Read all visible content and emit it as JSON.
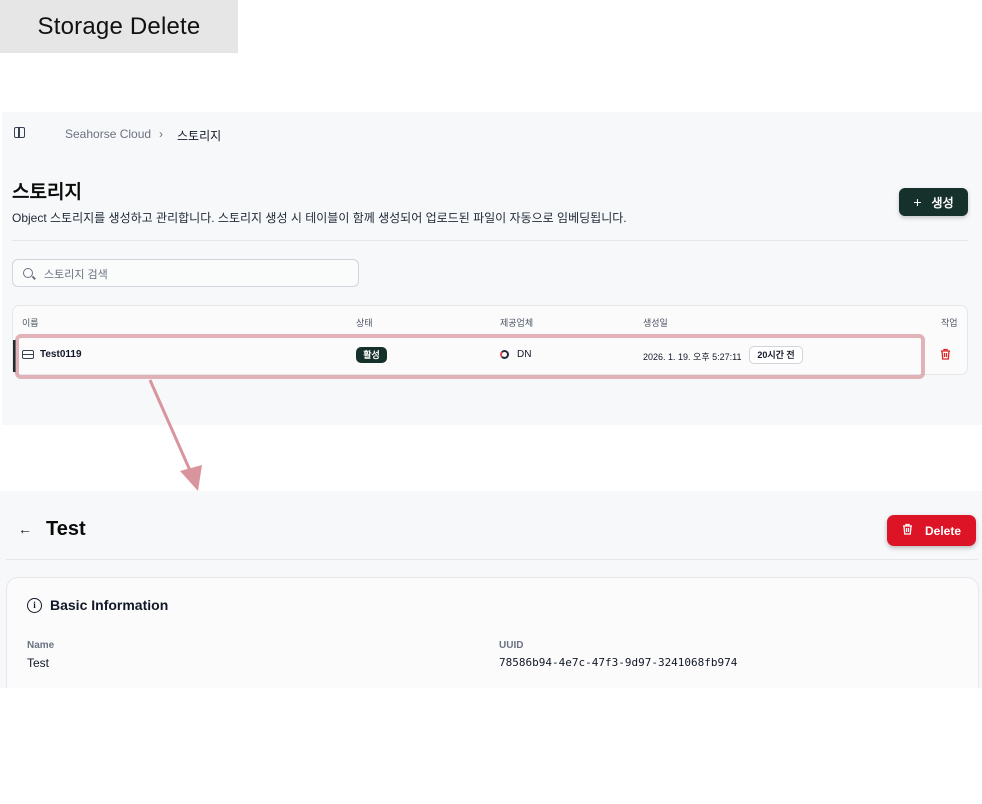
{
  "title_tab": "Storage Delete",
  "breadcrumb": {
    "root": "Seahorse Cloud",
    "separator": "›",
    "current": "스토리지"
  },
  "storage_list": {
    "title": "스토리지",
    "description": "Object 스토리지를 생성하고 관리합니다. 스토리지 생성 시 테이블이 함께 생성되어 업로드된 파일이 자동으로 임베딩됩니다.",
    "create_button": {
      "icon": "+",
      "label": "생성"
    },
    "search_placeholder": "스토리지 검색",
    "columns": [
      "이름",
      "상태",
      "제공업체",
      "생성일",
      "작업"
    ],
    "rows": [
      {
        "name": "Test0119",
        "status": "활성",
        "provider": "DN",
        "created": "2026. 1. 19. 오후 5:27:11",
        "relative": "20시간 전"
      }
    ]
  },
  "detail": {
    "back": "←",
    "title": "Test",
    "delete_button": "Delete",
    "section_title": "Basic Information",
    "fields": [
      {
        "label": "Name",
        "value": "Test"
      },
      {
        "label": "UUID",
        "value": "78586b94-4e7c-47f3-9d97-3241068fb974"
      }
    ]
  },
  "colors": {
    "primary": "#16302b",
    "danger": "#dc1426",
    "highlight": "#d2828c"
  },
  "icons": [
    "sidebar-toggle-icon",
    "search-icon",
    "disk-icon",
    "provider-logo-icon",
    "trash-icon",
    "plus-icon",
    "back-arrow-icon",
    "info-icon"
  ]
}
